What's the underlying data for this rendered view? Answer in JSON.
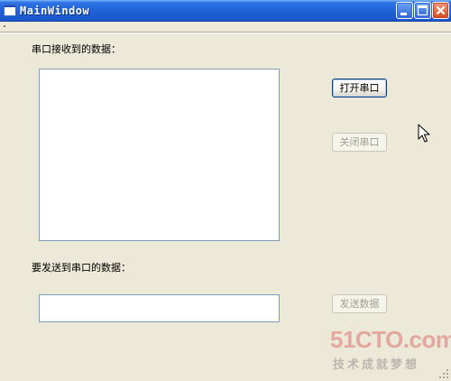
{
  "window": {
    "title": "MainWindow"
  },
  "labels": {
    "receive": "串口接收到的数据：",
    "send": "要发送到串口的数据："
  },
  "buttons": {
    "open_port": "打开串口",
    "close_port": "关闭串口",
    "send_data": "发送数据"
  },
  "state": {
    "close_port_enabled": false,
    "send_data_enabled": false
  },
  "watermark": {
    "logo": "51CTO.com",
    "tagline": "技术成就梦想"
  },
  "icons": {
    "app": "window-icon",
    "minimize": "minimize-icon",
    "maximize": "maximize-icon",
    "close": "close-icon",
    "cursor": "arrow-cursor-icon",
    "grip": "size-grip-icon"
  },
  "colors": {
    "titlebar": "#1d5fd6",
    "window_bg": "#ece9d8",
    "close_button": "#d34b22",
    "watermark": "#e2a79f"
  }
}
